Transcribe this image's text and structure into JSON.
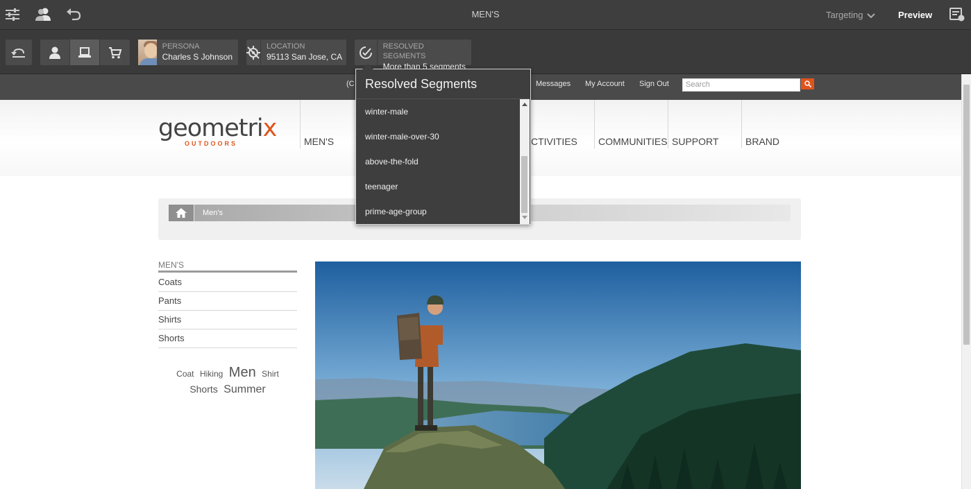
{
  "topbar": {
    "page_title": "MEN'S",
    "targeting_label": "Targeting",
    "preview_label": "Preview"
  },
  "contexthub": {
    "persona": {
      "label": "PERSONA",
      "value": "Charles S Johnson"
    },
    "location": {
      "label": "LOCATION",
      "value": "95113 San Jose, CA"
    },
    "segments": {
      "label": "RESOLVED SEGMENTS",
      "value": "More than 5 segments"
    }
  },
  "popover": {
    "title": "Resolved Segments",
    "items": [
      "winter-male",
      "winter-male-over-30",
      "above-the-fold",
      "teenager",
      "prime-age-group"
    ]
  },
  "site": {
    "top_links": {
      "hidden_partial": "(C",
      "messages": "Messages",
      "account": "My Account",
      "signout": "Sign Out"
    },
    "search_placeholder": "Search",
    "logo": {
      "pre": "geometri",
      "x": "x",
      "tagline": "OUTDOORS"
    },
    "nav": [
      "MEN'S",
      "CTIVITIES",
      "COMMUNITIES",
      "SUPPORT",
      "BRAND"
    ],
    "breadcrumb": "Men's",
    "sidebar": {
      "title": "MEN'S",
      "items": [
        "Coats",
        "Pants",
        "Shirts",
        "Shorts"
      ]
    },
    "tags": [
      "Coat",
      "Hiking",
      "Men",
      "Shirt",
      "Shorts",
      "Summer"
    ]
  },
  "colors": {
    "accent": "#e0541c",
    "toolbar": "#3e3e3e"
  }
}
